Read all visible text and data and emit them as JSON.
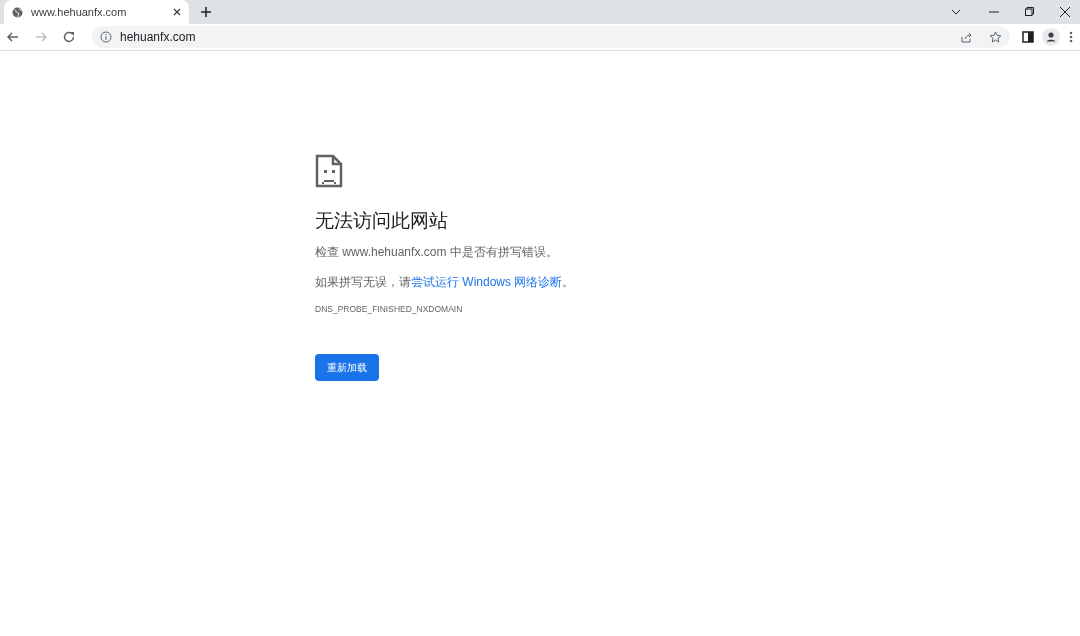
{
  "tabs": [
    {
      "title": "www.hehuanfx.com",
      "selected": true
    }
  ],
  "address_bar": {
    "url": "hehuanfx.com"
  },
  "error": {
    "title": "无法访问此网站",
    "check_text": "检查 www.hehuanfx.com 中是否有拼写错误。",
    "suggestion": {
      "before": "如果拼写无误，请",
      "link": "尝试运行 Windows 网络诊断",
      "after": "。"
    },
    "code": "DNS_PROBE_FINISHED_NXDOMAIN",
    "button": "重新加载"
  }
}
